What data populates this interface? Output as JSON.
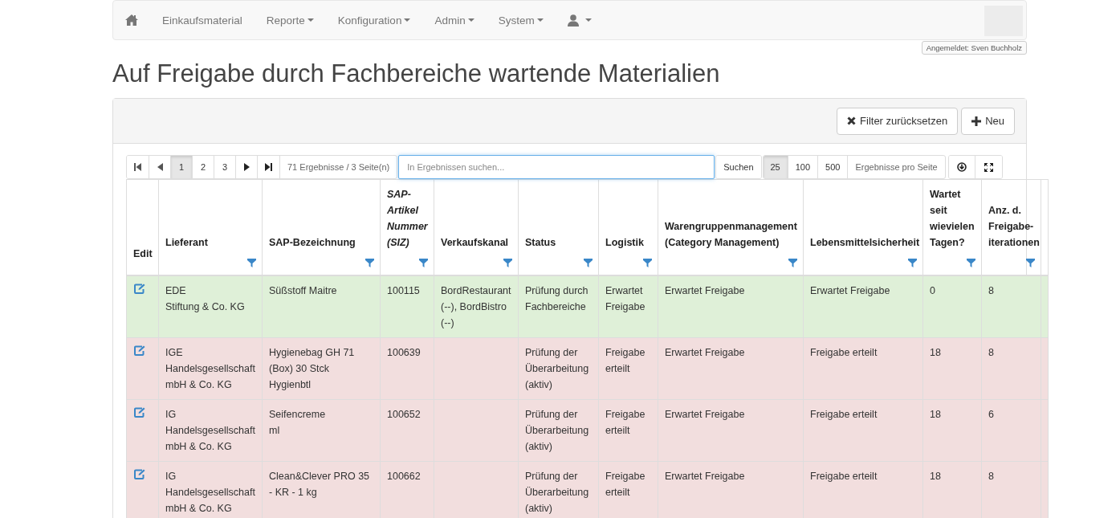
{
  "navbar": {
    "items": [
      {
        "label": "Einkaufsmaterial",
        "dropdown": false
      },
      {
        "label": "Reporte",
        "dropdown": true
      },
      {
        "label": "Konfiguration",
        "dropdown": true
      },
      {
        "label": "Admin",
        "dropdown": true
      },
      {
        "label": "System",
        "dropdown": true
      }
    ],
    "user_dropdown": true
  },
  "logged_in": "Angemeldet: Sven Buchholz",
  "title": "Auf Freigabe durch Fachbereiche wartende Materialien",
  "actions": [
    {
      "kind": "reset",
      "label": "Filter zurücksetzen"
    },
    {
      "kind": "new",
      "label": "Neu"
    }
  ],
  "pagination": {
    "pages": [
      {
        "label": "1",
        "selected": true
      },
      {
        "label": "2",
        "selected": false
      },
      {
        "label": "3",
        "selected": false
      }
    ],
    "summary": "71 Ergebnisse / 3 Seite(n)"
  },
  "search": {
    "placeholder": "In Ergebnissen suchen...",
    "button": "Suchen"
  },
  "page_sizes": [
    {
      "label": "25",
      "selected": true
    },
    {
      "label": "100",
      "selected": false
    },
    {
      "label": "500",
      "selected": false
    }
  ],
  "page_size_label": "Ergebnisse pro Seite",
  "table": {
    "columns": [
      {
        "label": "Edit",
        "filter": false,
        "italic": false
      },
      {
        "label": "Lieferant",
        "filter": true,
        "italic": false
      },
      {
        "label": "SAP-Bezeichnung",
        "filter": true,
        "italic": false
      },
      {
        "label": "SAP-Artikel Nummer (SIZ)",
        "filter": true,
        "italic": true
      },
      {
        "label": "Verkaufskanal",
        "filter": true,
        "italic": false
      },
      {
        "label": "Status",
        "filter": true,
        "italic": false
      },
      {
        "label": "Logistik",
        "filter": true,
        "italic": false
      },
      {
        "label": "Warengruppenmanagement (Category Management)",
        "filter": true,
        "italic": false
      },
      {
        "label": "Lebensmittelsicherheit",
        "filter": true,
        "italic": false
      },
      {
        "label": "Wartet seit wievielen Tagen?",
        "filter": true,
        "italic": false
      },
      {
        "label": "Anz. d. Freigabe-iterationen",
        "filter": true,
        "italic": false
      }
    ],
    "rows": [
      {
        "kind": "success",
        "cells": [
          "",
          "EDE\nStiftung & Co. KG",
          "Süßstoff Maitre",
          "100115",
          "BordRestaurant (--), BordBistro (--)",
          "Prüfung durch Fachbereiche",
          "Erwartet Freigabe",
          "Erwartet Freigabe",
          "Erwartet Freigabe",
          "0",
          "8"
        ]
      },
      {
        "kind": "danger",
        "cells": [
          "",
          "IGE Handelsgesellschaft mbH & Co. KG",
          "Hygienebag GH 71 (Box) 30 Stck Hygienbtl",
          "100639",
          "",
          "Prüfung der Überarbeitung (aktiv)",
          "Freigabe erteilt",
          "Erwartet Freigabe",
          "Freigabe erteilt",
          "18",
          "8"
        ]
      },
      {
        "kind": "danger",
        "cells": [
          "",
          "IG Handelsgesellschaft mbH & Co. KG",
          "Seifencreme\nml",
          "100652",
          "",
          "Prüfung der Überarbeitung (aktiv)",
          "Freigabe erteilt",
          "Erwartet Freigabe",
          "Freigabe erteilt",
          "18",
          "6"
        ]
      },
      {
        "kind": "danger",
        "cells": [
          "",
          "IG Handelsgesellschaft mbH & Co. KG",
          "Clean&Clever PRO 35 - KR - 1 kg",
          "100662",
          "",
          "Prüfung der Überarbeitung (aktiv)",
          "Freigabe erteilt",
          "Erwartet Freigabe",
          "Freigabe erteilt",
          "18",
          "8"
        ]
      }
    ]
  }
}
